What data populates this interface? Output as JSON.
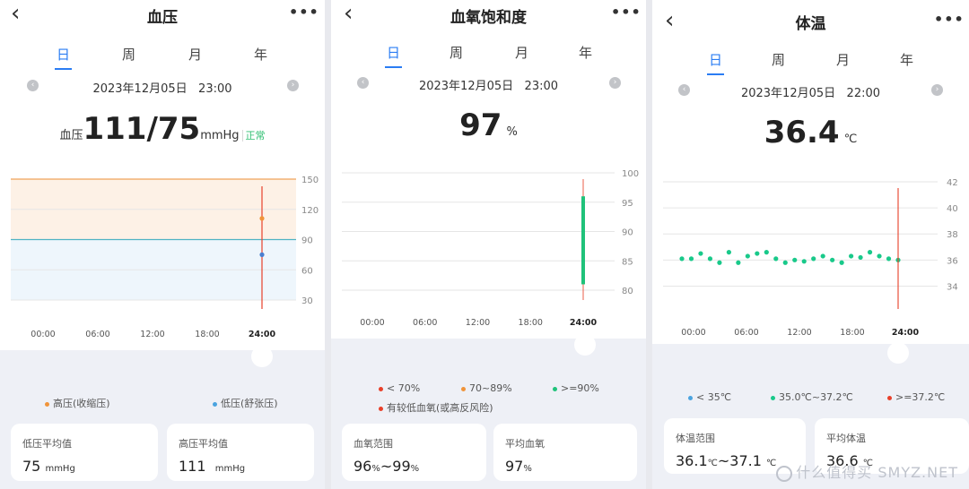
{
  "tabs": [
    "日",
    "周",
    "月",
    "年"
  ],
  "more": "•••",
  "back": "‹",
  "nav_prev": "‹",
  "nav_next": "›",
  "bp": {
    "title": "血压",
    "date": "2023年12月05日",
    "time": "23:00",
    "reading_prefix": "血压",
    "reading_value": "111/75",
    "reading_unit": "mmHg",
    "status": "正常",
    "legend": [
      "高压(收缩压)",
      "低压(舒张压)"
    ],
    "cards": [
      {
        "label": "低压平均值",
        "value": "75",
        "unit": "mmHg"
      },
      {
        "label": "高压平均值",
        "value": "111",
        "unit": "mmHg"
      }
    ]
  },
  "spo2": {
    "title": "血氧饱和度",
    "date": "2023年12月05日",
    "time": "23:00",
    "reading_value": "97",
    "reading_unit": "%",
    "legend": [
      "< 70%",
      "70~89%",
      ">=90%",
      "有较低血氧(或高反风险)"
    ],
    "cards": [
      {
        "label": "血氧范围",
        "value": "96",
        "unit1": "%",
        "sep": "~",
        "value2": "99",
        "unit": "%"
      },
      {
        "label": "平均血氧",
        "value": "97",
        "unit": "%"
      }
    ]
  },
  "temp": {
    "title": "体温",
    "date": "2023年12月05日",
    "time": "22:00",
    "reading_value": "36.4",
    "reading_unit": "℃",
    "legend": [
      "< 35℃",
      "35.0℃~37.2℃",
      ">=37.2℃"
    ],
    "cards": [
      {
        "label": "体温范围",
        "value": "36.1",
        "unit1": "℃",
        "sep": "~",
        "value2": "37.1",
        "unit": "℃"
      },
      {
        "label": "平均体温",
        "value": "36.6",
        "unit": "℃"
      }
    ]
  },
  "watermark": "什么值得买",
  "watermark_site": "SMYZ.NET",
  "colors": {
    "accent": "#2a7cf3",
    "normal": "#2fbf71",
    "high": "#f0943a",
    "low": "#4aa3df",
    "danger": "#e8402a",
    "spo2_bar": "#1fc27a",
    "temp_dot": "#19c98a"
  },
  "chart_data": [
    {
      "type": "line",
      "title": "",
      "x_ticks": [
        "00:00",
        "06:00",
        "12:00",
        "18:00",
        "24:00"
      ],
      "y_ticks": [
        150,
        120,
        90,
        60,
        30
      ],
      "ylim": [
        30,
        150
      ],
      "bands": [
        {
          "from": 90,
          "to": 150,
          "color": "#f0943a"
        },
        {
          "from": 30,
          "to": 90,
          "color": "#4aa3df"
        }
      ],
      "series": [
        {
          "name": "高压(收缩压)",
          "x": [
            24
          ],
          "values": [
            111
          ]
        },
        {
          "name": "低压(舒张压)",
          "x": [
            24
          ],
          "values": [
            75
          ]
        }
      ],
      "legend_position": "bottom"
    },
    {
      "type": "bar",
      "title": "",
      "x_ticks": [
        "00:00",
        "06:00",
        "12:00",
        "18:00",
        "24:00"
      ],
      "y_ticks": [
        100,
        95,
        90,
        85,
        80
      ],
      "ylim": [
        80,
        100
      ],
      "series": [
        {
          "x": [
            24
          ],
          "low": [
            81
          ],
          "high": [
            96
          ]
        }
      ],
      "legend_position": "bottom"
    },
    {
      "type": "scatter",
      "title": "",
      "x_ticks": [
        "00:00",
        "06:00",
        "12:00",
        "18:00",
        "24:00"
      ],
      "y_ticks": [
        42,
        40,
        38,
        36,
        34
      ],
      "ylim": [
        33,
        42
      ],
      "series": [
        {
          "x": [
            0,
            1,
            2,
            3,
            4,
            5,
            6,
            7,
            8,
            9,
            10,
            11,
            12,
            13,
            14,
            15,
            16,
            17,
            18,
            19,
            20,
            21,
            22,
            23
          ],
          "values": [
            36.1,
            36.1,
            36.5,
            36.1,
            35.8,
            36.6,
            35.8,
            36.3,
            36.5,
            36.6,
            36.1,
            35.8,
            36.0,
            35.9,
            36.1,
            36.3,
            36.0,
            35.8,
            36.3,
            36.2,
            36.6,
            36.3,
            36.1,
            36.0
          ]
        }
      ],
      "legend_position": "bottom"
    }
  ]
}
